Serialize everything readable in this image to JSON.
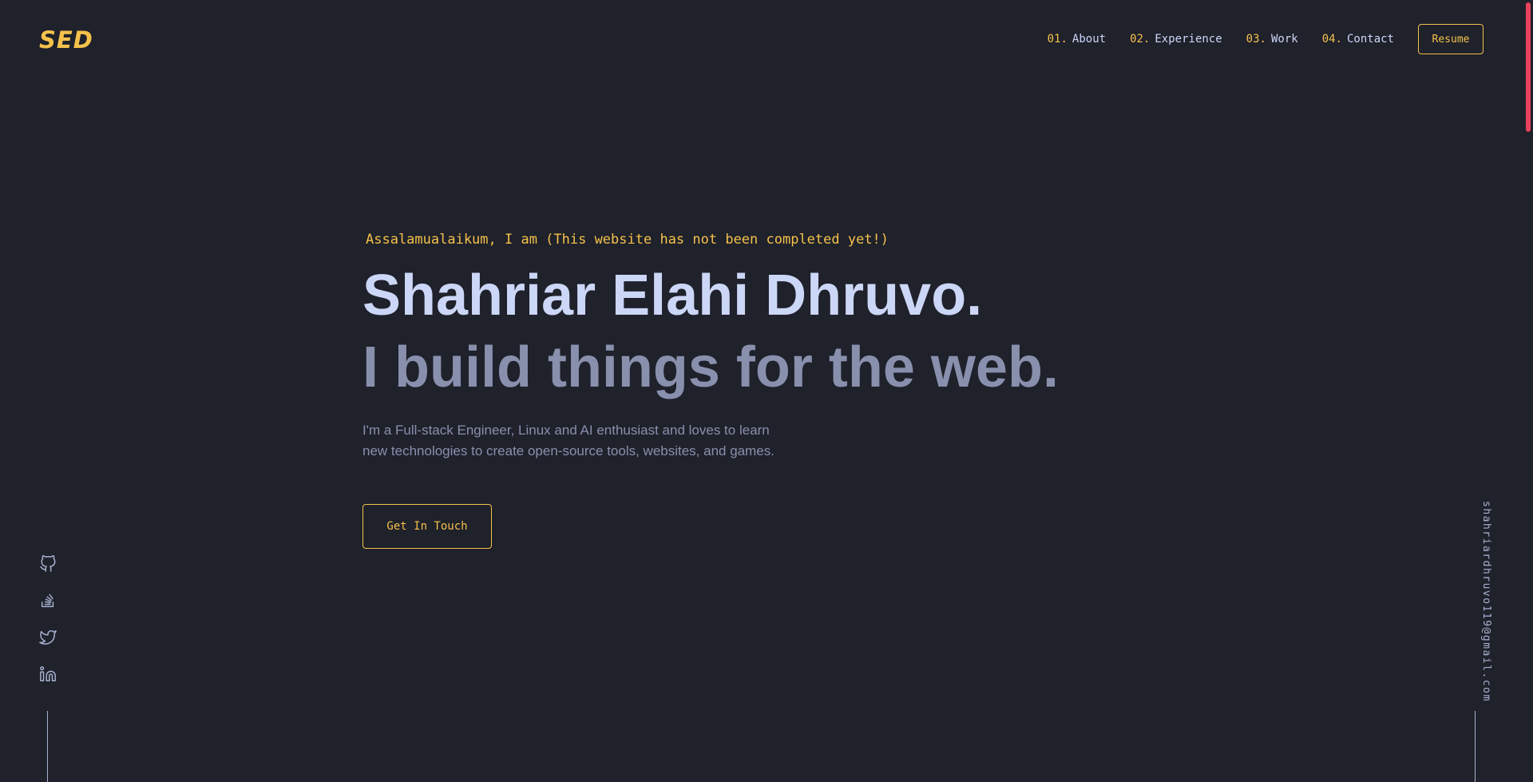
{
  "header": {
    "logo": "SED",
    "nav": [
      {
        "num": "01.",
        "label": "About"
      },
      {
        "num": "02.",
        "label": "Experience"
      },
      {
        "num": "03.",
        "label": "Work"
      },
      {
        "num": "04.",
        "label": "Contact"
      }
    ],
    "resume_label": "Resume"
  },
  "hero": {
    "greeting": "Assalamualaikum, I am (This website has not been completed yet!)",
    "name": "Shahriar Elahi Dhruvo.",
    "tagline": "I build things for the web.",
    "description": "I'm a Full-stack Engineer, Linux and AI enthusiast and loves to learn new technologies to create open-source tools, websites, and games.",
    "cta_label": "Get In Touch"
  },
  "socials": [
    {
      "icon": "github-icon"
    },
    {
      "icon": "stackoverflow-icon"
    },
    {
      "icon": "twitter-icon"
    },
    {
      "icon": "linkedin-icon"
    }
  ],
  "email": "shahriardhruvo119@gmail.com",
  "colors": {
    "background": "#1f212b",
    "accent": "#f5c14b",
    "heading": "#ccd6f6",
    "muted": "#8990ad",
    "scroll_thumb": "#e8435d"
  }
}
